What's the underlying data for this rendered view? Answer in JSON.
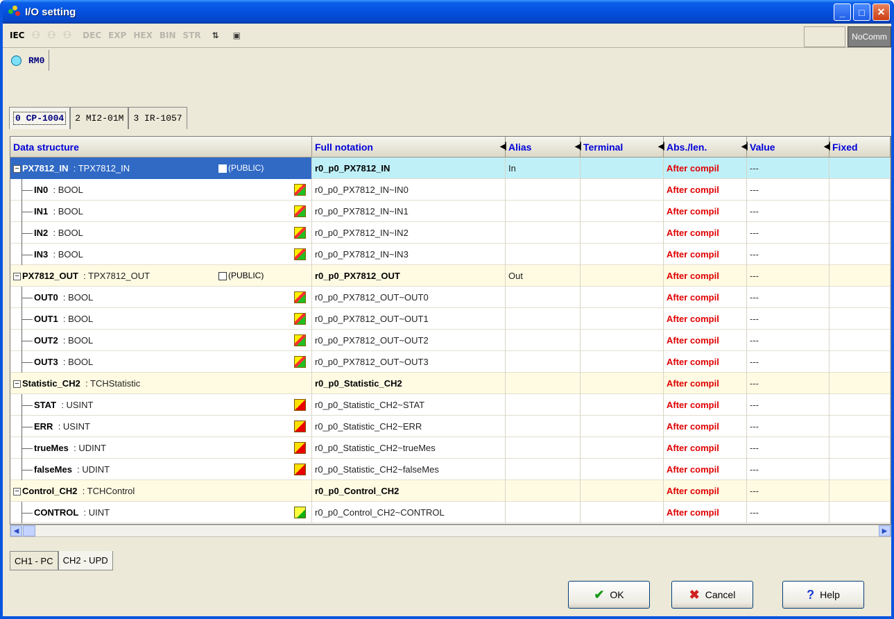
{
  "window": {
    "title": "I/O setting"
  },
  "toolbar": {
    "items": [
      "IEC",
      "DEC",
      "EXP",
      "HEX",
      "BIN",
      "STR"
    ],
    "status": "NoComm"
  },
  "rm_tab": {
    "label": "RM0"
  },
  "module_tabs": [
    {
      "label": "0 CP-1004"
    },
    {
      "label": "2 MI2-01M"
    },
    {
      "label": "3 IR-1057"
    }
  ],
  "columns": [
    "Data structure",
    "Full notation",
    "Alias",
    "Terminal",
    "Abs./len.",
    "Value",
    "Fixed"
  ],
  "rows": [
    {
      "name": "PX7812_IN",
      "type": ": TPX7812_IN",
      "public": "(PUBLIC)",
      "full": "r0_p0_PX7812_IN",
      "alias": "In",
      "abs": "After compil",
      "value": "---",
      "group": true
    },
    {
      "name": "IN0",
      "type": ": BOOL",
      "full": "r0_p0_PX7812_IN~IN0",
      "abs": "After compil",
      "value": "---",
      "icon": "in"
    },
    {
      "name": "IN1",
      "type": ": BOOL",
      "full": "r0_p0_PX7812_IN~IN1",
      "abs": "After compil",
      "value": "---",
      "icon": "in"
    },
    {
      "name": "IN2",
      "type": ": BOOL",
      "full": "r0_p0_PX7812_IN~IN2",
      "abs": "After compil",
      "value": "---",
      "icon": "in"
    },
    {
      "name": "IN3",
      "type": ": BOOL",
      "full": "r0_p0_PX7812_IN~IN3",
      "abs": "After compil",
      "value": "---",
      "icon": "in"
    },
    {
      "name": "PX7812_OUT",
      "type": ": TPX7812_OUT",
      "public": "(PUBLIC)",
      "full": "r0_p0_PX7812_OUT",
      "alias": "Out",
      "abs": "After compil",
      "value": "---",
      "group": true
    },
    {
      "name": "OUT0",
      "type": ": BOOL",
      "full": "r0_p0_PX7812_OUT~OUT0",
      "abs": "After compil",
      "value": "---",
      "icon": "in"
    },
    {
      "name": "OUT1",
      "type": ": BOOL",
      "full": "r0_p0_PX7812_OUT~OUT1",
      "abs": "After compil",
      "value": "---",
      "icon": "in"
    },
    {
      "name": "OUT2",
      "type": ": BOOL",
      "full": "r0_p0_PX7812_OUT~OUT2",
      "abs": "After compil",
      "value": "---",
      "icon": "in"
    },
    {
      "name": "OUT3",
      "type": ": BOOL",
      "full": "r0_p0_PX7812_OUT~OUT3",
      "abs": "After compil",
      "value": "---",
      "icon": "in"
    },
    {
      "name": "Statistic_CH2",
      "type": ": TCHStatistic",
      "full": "r0_p0_Statistic_CH2",
      "abs": "After compil",
      "value": "---",
      "group": true
    },
    {
      "name": "STAT",
      "type": ": USINT",
      "full": "r0_p0_Statistic_CH2~STAT",
      "abs": "After compil",
      "value": "---",
      "icon": "st"
    },
    {
      "name": "ERR",
      "type": ": USINT",
      "full": "r0_p0_Statistic_CH2~ERR",
      "abs": "After compil",
      "value": "---",
      "icon": "st"
    },
    {
      "name": "trueMes",
      "type": ": UDINT",
      "full": "r0_p0_Statistic_CH2~trueMes",
      "abs": "After compil",
      "value": "---",
      "icon": "st"
    },
    {
      "name": "falseMes",
      "type": ": UDINT",
      "full": "r0_p0_Statistic_CH2~falseMes",
      "abs": "After compil",
      "value": "---",
      "icon": "st"
    },
    {
      "name": "Control_CH2",
      "type": ": TCHControl",
      "full": "r0_p0_Control_CH2",
      "abs": "After compil",
      "value": "---",
      "group": true
    },
    {
      "name": "CONTROL",
      "type": ": UINT",
      "full": "r0_p0_Control_CH2~CONTROL",
      "abs": "After compil",
      "value": "---",
      "icon": "ct"
    }
  ],
  "channel_tabs": [
    {
      "label": "CH1 - PC"
    },
    {
      "label": "CH2 - UPD"
    }
  ],
  "buttons": {
    "ok": "OK",
    "cancel": "Cancel",
    "help": "Help"
  }
}
